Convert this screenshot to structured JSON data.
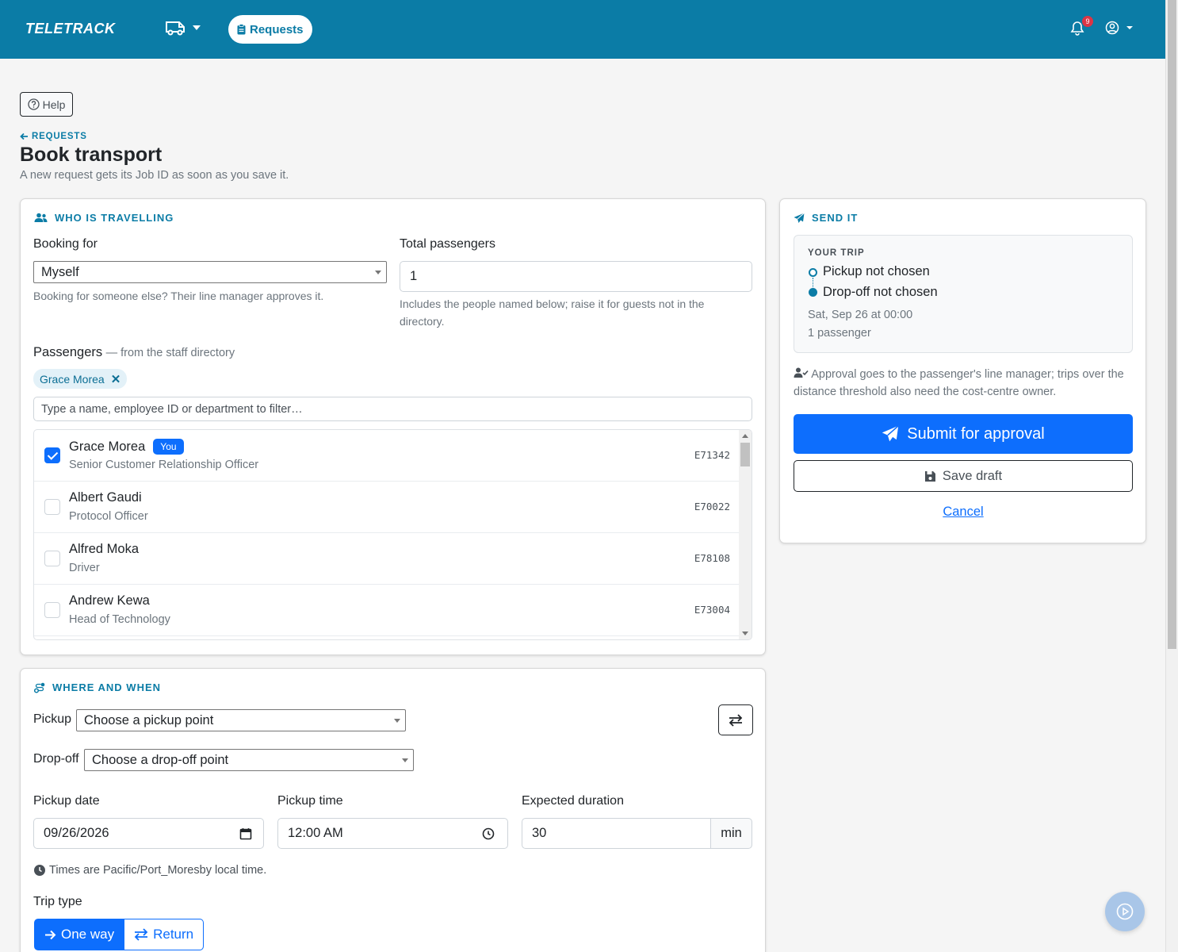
{
  "nav": {
    "brand": "TELETRACK",
    "requests_label": "Requests",
    "notification_count": "9"
  },
  "header": {
    "help_label": "Help",
    "back_label": "REQUESTS",
    "title": "Book transport",
    "subtitle": "A new request gets its Job ID as soon as you save it."
  },
  "who": {
    "section_title": "WHO IS TRAVELLING",
    "booking_for_label": "Booking for",
    "booking_for_value": "Myself",
    "booking_for_help": "Booking for someone else? Their line manager approves it.",
    "total_label": "Total passengers",
    "total_value": "1",
    "total_help": "Includes the people named below; raise it for guests not in the directory.",
    "passengers_label": "Passengers",
    "passengers_sub": "— from the staff directory",
    "chip_label": "Grace Morea",
    "filter_placeholder": "Type a name, employee ID or department to filter…",
    "you_badge": "You",
    "people": [
      {
        "name": "Grace Morea",
        "role": "Senior Customer Relationship Officer",
        "id": "E71342",
        "checked": true
      },
      {
        "name": "Albert Gaudi",
        "role": "Protocol Officer",
        "id": "E70022",
        "checked": false
      },
      {
        "name": "Alfred Moka",
        "role": "Driver",
        "id": "E78108",
        "checked": false
      },
      {
        "name": "Andrew Kewa",
        "role": "Head of Technology",
        "id": "E73004",
        "checked": false
      }
    ]
  },
  "where": {
    "section_title": "WHERE AND WHEN",
    "pickup_label": "Pickup",
    "pickup_value": "Choose a pickup point",
    "dropoff_label": "Drop-off",
    "dropoff_value": "Choose a drop-off point",
    "date_label": "Pickup date",
    "date_value": "09/26/2026",
    "time_label": "Pickup time",
    "time_value": "12:00 AM",
    "duration_label": "Expected duration",
    "duration_value": "30",
    "duration_unit": "min",
    "tz_note": "Times are Pacific/Port_Moresby local time.",
    "trip_type_label": "Trip type",
    "one_way_label": "One way",
    "return_label": "Return"
  },
  "send": {
    "section_title": "SEND IT",
    "trip_heading": "YOUR TRIP",
    "pickup_status": "Pickup not chosen",
    "dropoff_status": "Drop-off not chosen",
    "when": "Sat, Sep 26 at 00:00",
    "pax": "1 passenger",
    "approval_note": "Approval goes to the passenger's line manager; trips over the distance threshold also need the cost-centre owner.",
    "submit_label": "Submit for approval",
    "draft_label": "Save draft",
    "cancel_label": "Cancel"
  },
  "colors": {
    "navbar": "#0b7ca6",
    "primary": "#0d6efd",
    "badge": "#dc3545"
  },
  "icons": [
    "van-icon",
    "clipboard-icon",
    "bell-icon",
    "user-circle-icon",
    "question-circle-icon",
    "arrow-left-icon",
    "users-icon",
    "paper-plane-icon",
    "route-icon",
    "swap-icon",
    "calendar-icon",
    "clock-icon",
    "user-check-icon",
    "floppy-icon",
    "arrow-right-icon",
    "play-circle-icon"
  ]
}
